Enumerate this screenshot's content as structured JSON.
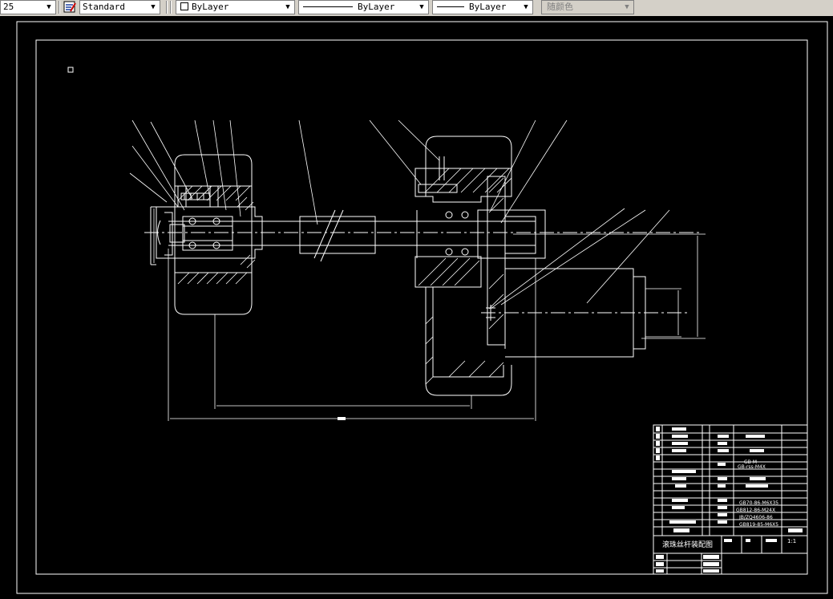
{
  "toolbar": {
    "scale_value": "25",
    "text_style": "Standard",
    "layer": "ByLayer",
    "linetype": "ByLayer",
    "lineweight": "ByLayer",
    "plot_style": "随颜色"
  },
  "drawing": {
    "title_block_name": "滚珠丝杆装配图",
    "scale": "1:1",
    "part_codes": {
      "p1": "GB70-86-M6X35",
      "p2": "GB812-86-M24X",
      "p3": "JB/ZQ4606-86",
      "p4": "GB819-85-M6X5",
      "p5": "GB-rss-M4X",
      "p6": "GB-M-"
    }
  }
}
